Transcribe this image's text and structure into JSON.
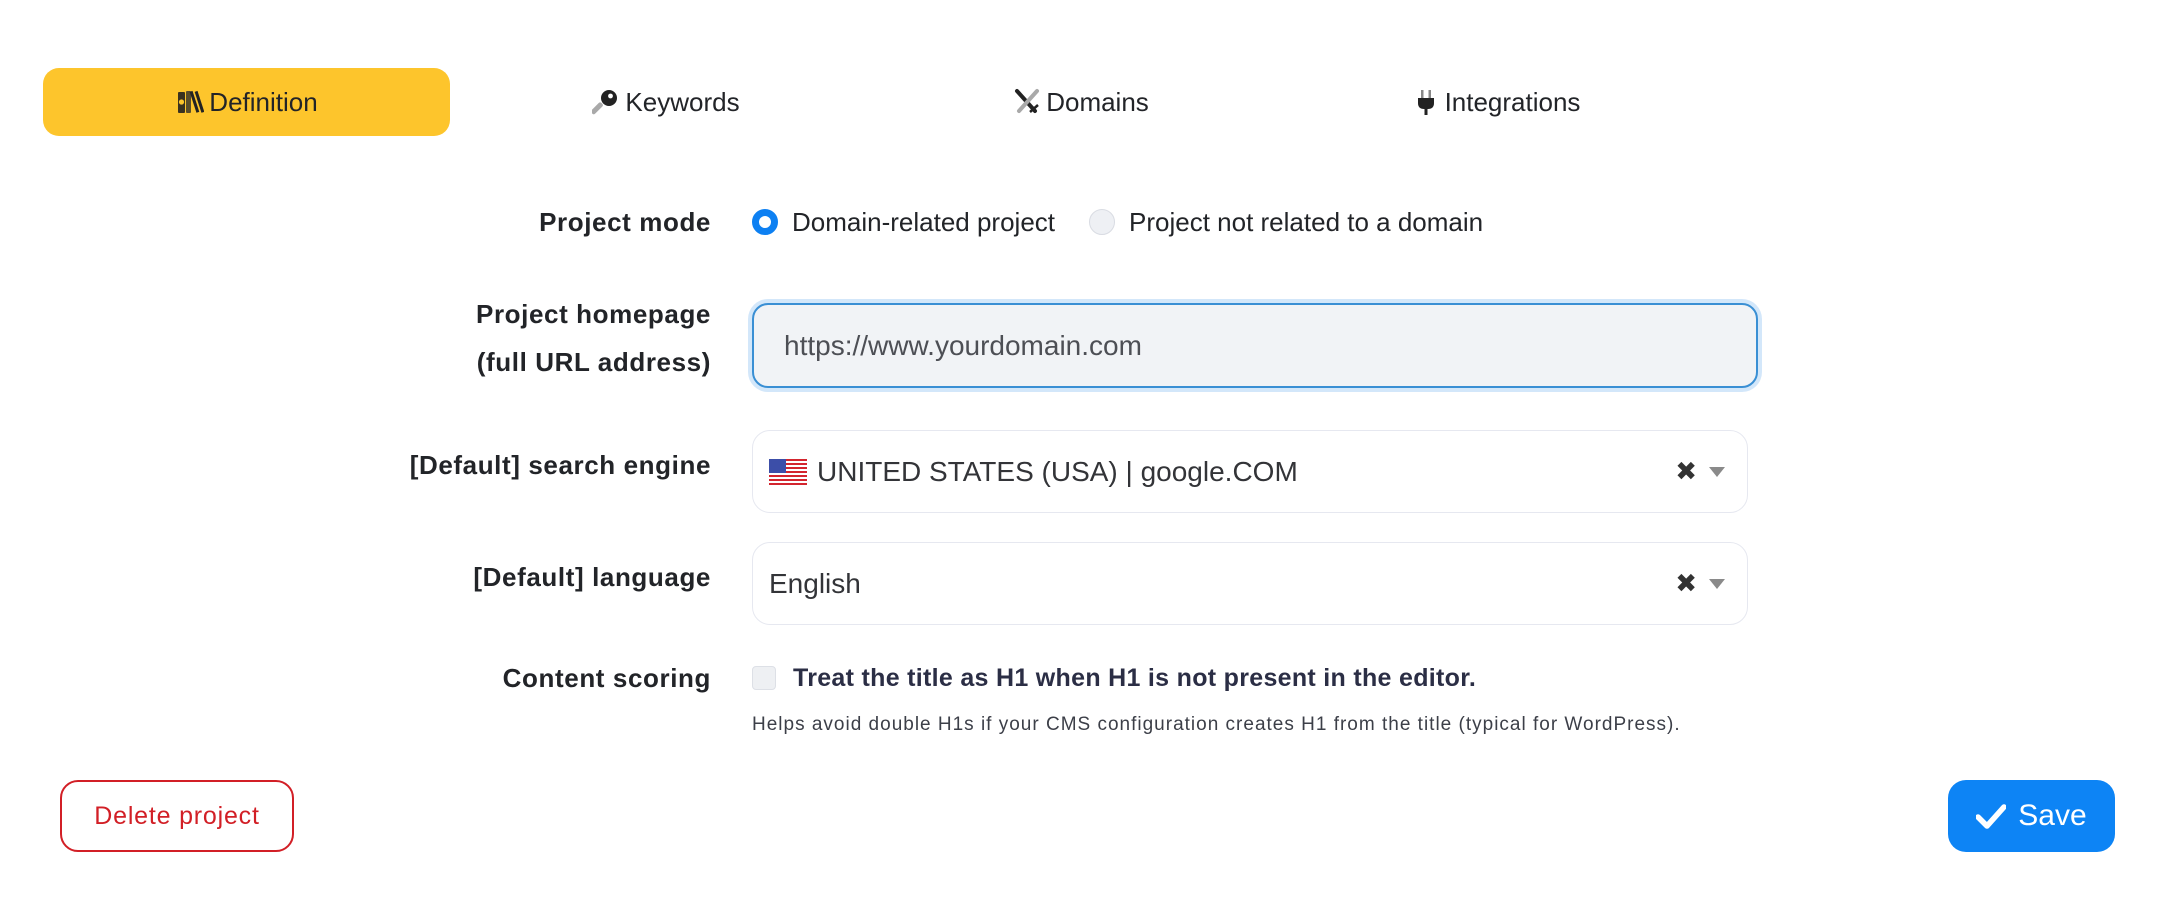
{
  "tabs": [
    {
      "label": "Definition",
      "icon": "books-icon",
      "active": true
    },
    {
      "label": "Keywords",
      "icon": "key-icon",
      "active": false
    },
    {
      "label": "Domains",
      "icon": "crossed-swords-icon",
      "active": false
    },
    {
      "label": "Integrations",
      "icon": "plug-icon",
      "active": false
    }
  ],
  "form": {
    "project_mode": {
      "label": "Project mode",
      "options": [
        {
          "label": "Domain-related project",
          "selected": true
        },
        {
          "label": "Project not related to a domain",
          "selected": false
        }
      ]
    },
    "homepage": {
      "label_line1": "Project homepage",
      "label_line2": "(full URL address)",
      "placeholder": "https://www.yourdomain.com",
      "value": ""
    },
    "search_engine": {
      "label": "[Default] search engine",
      "value": "UNITED STATES (USA) | google.COM",
      "flag": "us-flag-icon"
    },
    "language": {
      "label": "[Default] language",
      "value": "English"
    },
    "content_scoring": {
      "label": "Content scoring",
      "checkbox_label": "Treat the title as H1 when H1 is not present in the editor.",
      "checked": false,
      "help": "Helps avoid double H1s if your CMS configuration creates H1 from the title (typical for WordPress)."
    }
  },
  "actions": {
    "delete_label": "Delete project",
    "save_label": "Save"
  },
  "colors": {
    "active_tab": "#fdc52c",
    "primary": "#0d84f5",
    "danger": "#d21f26",
    "focus_border": "#3a8fd4"
  }
}
